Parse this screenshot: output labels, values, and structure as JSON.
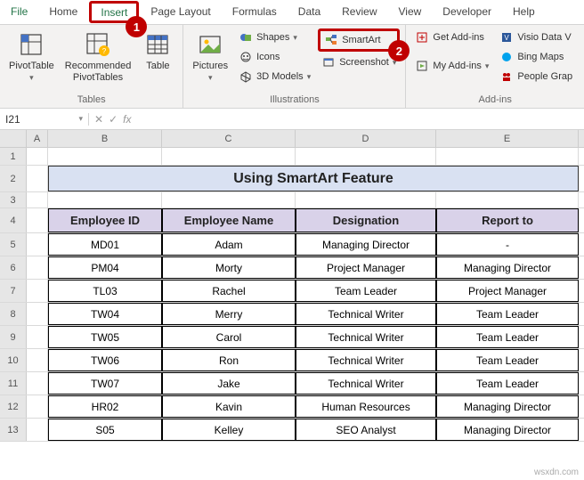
{
  "menu": {
    "tabs": [
      "File",
      "Home",
      "Insert",
      "Page Layout",
      "Formulas",
      "Data",
      "Review",
      "View",
      "Developer",
      "Help"
    ],
    "activeIndex": 2
  },
  "ribbon": {
    "tables": {
      "label": "Tables",
      "pivot": "PivotTable",
      "recommended": "Recommended\nPivotTables",
      "table": "Table"
    },
    "illustrations": {
      "label": "Illustrations",
      "pictures": "Pictures",
      "shapes": "Shapes",
      "icons": "Icons",
      "models": "3D Models",
      "smartart": "SmartArt",
      "screenshot": "Screenshot"
    },
    "addins": {
      "label": "Add-ins",
      "get": "Get Add-ins",
      "my": "My Add-ins",
      "visio": "Visio Data V",
      "bing": "Bing Maps",
      "people": "People Grap"
    }
  },
  "namebox": "I21",
  "fx_label": "fx",
  "columns": [
    "A",
    "B",
    "C",
    "D",
    "E"
  ],
  "title": "Using SmartArt Feature",
  "table": {
    "headers": [
      "Employee ID",
      "Employee Name",
      "Designation",
      "Report to"
    ],
    "rows": [
      [
        "MD01",
        "Adam",
        "Managing Director",
        "-"
      ],
      [
        "PM04",
        "Morty",
        "Project Manager",
        "Managing Director"
      ],
      [
        "TL03",
        "Rachel",
        "Team Leader",
        "Project Manager"
      ],
      [
        "TW04",
        "Merry",
        "Technical Writer",
        "Team Leader"
      ],
      [
        "TW05",
        "Carol",
        "Technical Writer",
        "Team Leader"
      ],
      [
        "TW06",
        "Ron",
        "Technical Writer",
        "Team Leader"
      ],
      [
        "TW07",
        "Jake",
        "Technical Writer",
        "Team Leader"
      ],
      [
        "HR02",
        "Kavin",
        "Human Resources",
        "Managing Director"
      ],
      [
        "S05",
        "Kelley",
        "SEO Analyst",
        "Managing Director"
      ]
    ]
  },
  "markers": {
    "one": "1",
    "two": "2"
  },
  "watermark": "wsxdn.com"
}
